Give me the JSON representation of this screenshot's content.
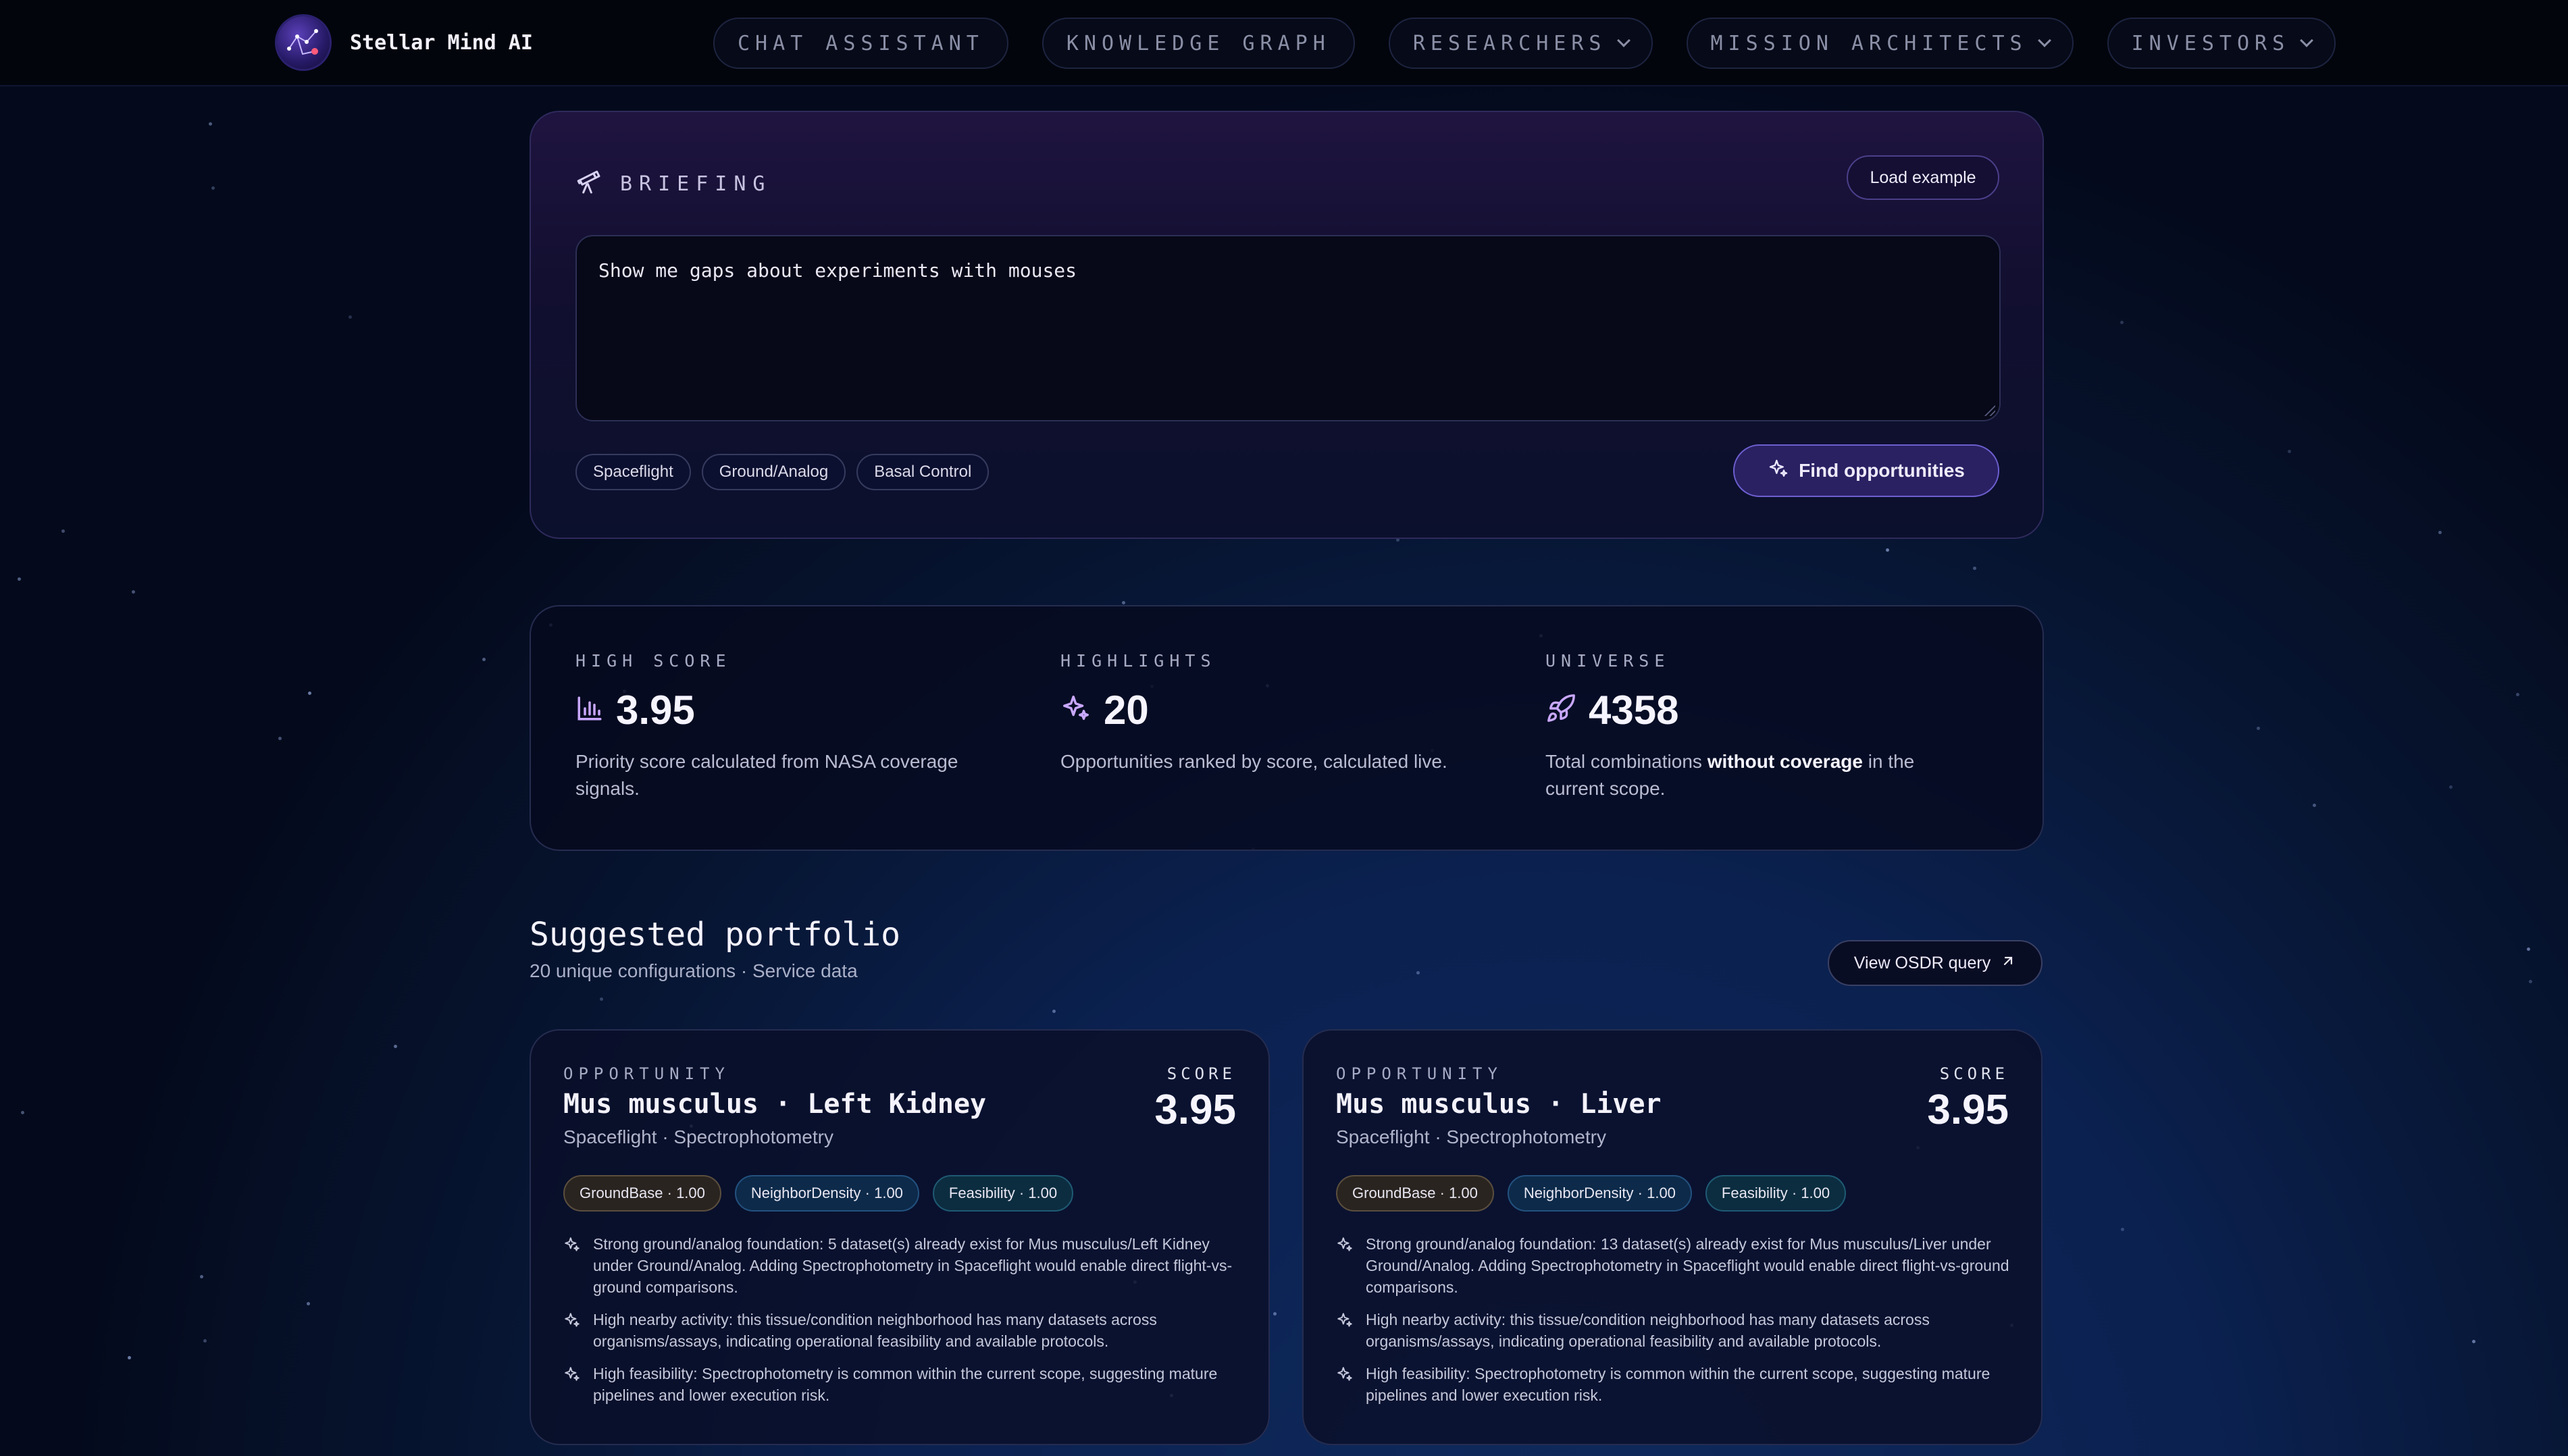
{
  "nav": {
    "brand": "Stellar Mind AI",
    "items": [
      {
        "label": "CHAT ASSISTANT",
        "dropdown": false
      },
      {
        "label": "KNOWLEDGE GRAPH",
        "dropdown": false
      },
      {
        "label": "RESEARCHERS",
        "dropdown": true
      },
      {
        "label": "MISSION ARCHITECTS",
        "dropdown": true
      },
      {
        "label": "INVESTORS",
        "dropdown": true
      }
    ]
  },
  "briefing": {
    "title": "BRIEFING",
    "load_example": "Load example",
    "query": "Show me gaps about experiments with mouses",
    "chips": [
      "Spaceflight",
      "Ground/Analog",
      "Basal Control"
    ],
    "find_button": "Find opportunities"
  },
  "stats": [
    {
      "label": "HIGH SCORE",
      "icon": "bar-chart-icon",
      "value": "3.95",
      "desc_parts": [
        "Priority score calculated from NASA coverage signals.",
        "",
        ""
      ]
    },
    {
      "label": "HIGHLIGHTS",
      "icon": "sparkle-icon",
      "value": "20",
      "desc_parts": [
        "Opportunities ranked by score, calculated live.",
        "",
        ""
      ]
    },
    {
      "label": "UNIVERSE",
      "icon": "rocket-icon",
      "value": "4358",
      "desc_parts": [
        "Total combinations ",
        "without coverage",
        " in the current scope."
      ]
    }
  ],
  "portfolio": {
    "title": "Suggested portfolio",
    "subtitle": "20 unique configurations · Service data",
    "osdr_button": "View OSDR query",
    "cards": [
      {
        "label": "OPPORTUNITY",
        "title": "Mus musculus · Left Kidney",
        "subtitle": "Spaceflight · Spectrophotometry",
        "score_label": "SCORE",
        "score": "3.95",
        "tags": [
          "GroundBase · 1.00",
          "NeighborDensity · 1.00",
          "Feasibility · 1.00"
        ],
        "bullets": [
          "Strong ground/analog foundation: 5 dataset(s) already exist for Mus musculus/Left Kidney under Ground/Analog. Adding Spectrophotometry in Spaceflight would enable direct flight-vs-ground comparisons.",
          "High nearby activity: this tissue/condition neighborhood has many datasets across organisms/assays, indicating operational feasibility and available protocols.",
          "High feasibility: Spectrophotometry is common within the current scope, suggesting mature pipelines and lower execution risk."
        ]
      },
      {
        "label": "OPPORTUNITY",
        "title": "Mus musculus · Liver",
        "subtitle": "Spaceflight · Spectrophotometry",
        "score_label": "SCORE",
        "score": "3.95",
        "tags": [
          "GroundBase · 1.00",
          "NeighborDensity · 1.00",
          "Feasibility · 1.00"
        ],
        "bullets": [
          "Strong ground/analog foundation: 13 dataset(s) already exist for Mus musculus/Liver under Ground/Analog. Adding Spectrophotometry in Spaceflight would enable direct flight-vs-ground comparisons.",
          "High nearby activity: this tissue/condition neighborhood has many datasets across organisms/assays, indicating operational feasibility and available protocols.",
          "High feasibility: Spectrophotometry is common within the current scope, suggesting mature pipelines and lower execution risk."
        ]
      }
    ]
  },
  "colors": {
    "accent": "#6d5fd0",
    "icon": "#c9a8ff",
    "background": "#0b2150"
  }
}
